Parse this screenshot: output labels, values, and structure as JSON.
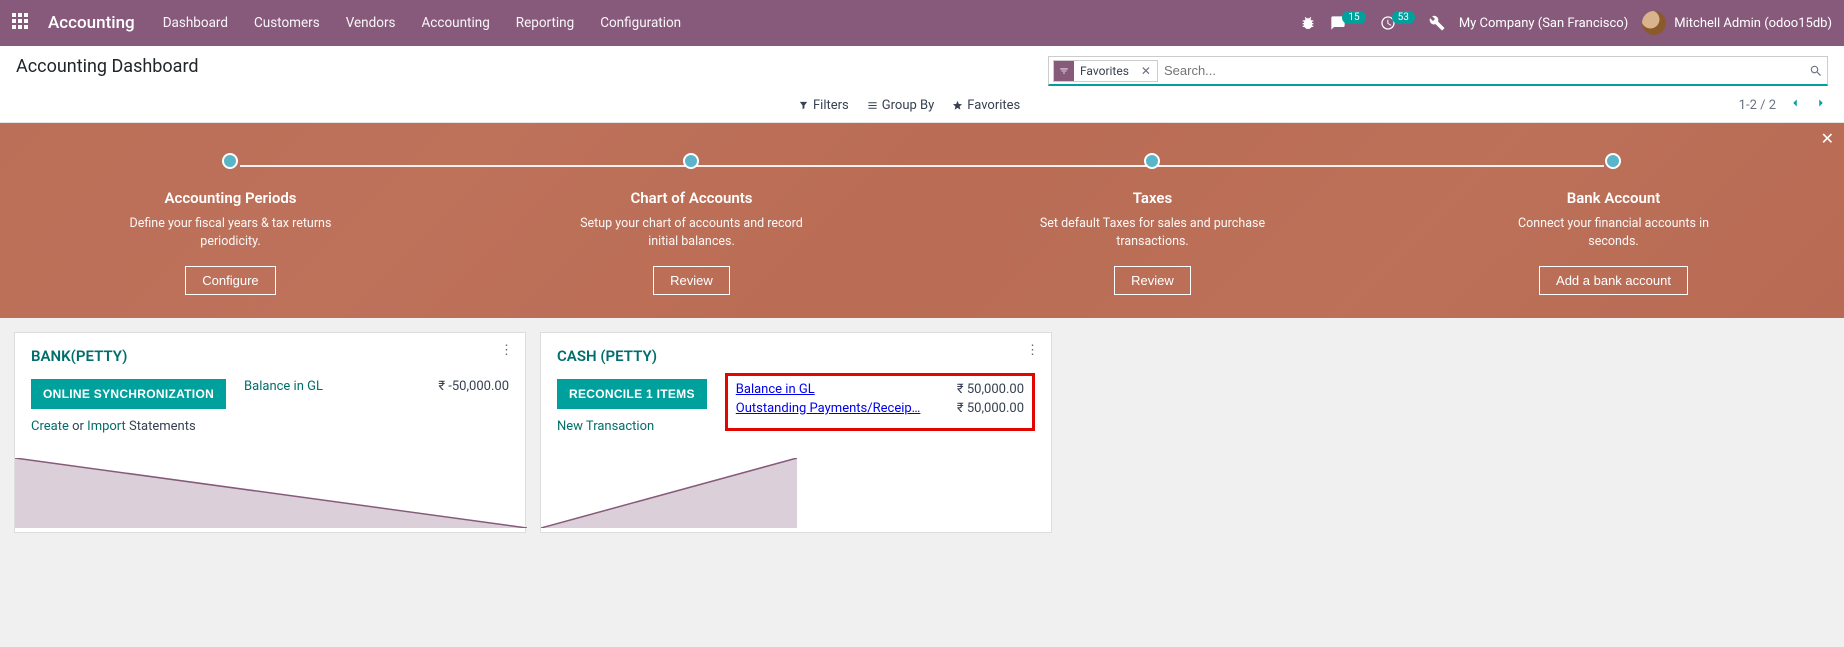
{
  "header": {
    "brand": "Accounting",
    "menu": [
      "Dashboard",
      "Customers",
      "Vendors",
      "Accounting",
      "Reporting",
      "Configuration"
    ],
    "badges": {
      "messages": "15",
      "activities": "53"
    },
    "company": "My Company (San Francisco)",
    "user": "Mitchell Admin (odoo15db)"
  },
  "control_panel": {
    "title": "Accounting Dashboard",
    "facet_label": "Favorites",
    "search_placeholder": "Search...",
    "tools": {
      "filters": "Filters",
      "groupby": "Group By",
      "favorites": "Favorites"
    },
    "pager": "1-2 / 2"
  },
  "onboard": {
    "steps": [
      {
        "title": "Accounting Periods",
        "desc": "Define your fiscal years & tax returns periodicity.",
        "action": "Configure"
      },
      {
        "title": "Chart of Accounts",
        "desc": "Setup your chart of accounts and record initial balances.",
        "action": "Review"
      },
      {
        "title": "Taxes",
        "desc": "Set default Taxes for sales and purchase transactions.",
        "action": "Review"
      },
      {
        "title": "Bank Account",
        "desc": "Connect your financial accounts in seconds.",
        "action": "Add a bank account"
      }
    ]
  },
  "cards": {
    "bank": {
      "title": "BANK(PETTY)",
      "primary_btn": "ONLINE SYNCHRONIZATION",
      "balance_label": "Balance in GL",
      "balance_value": "₹ -50,000.00",
      "link_create": "Create",
      "link_or": "or",
      "link_import": "Import",
      "link_tail": "Statements"
    },
    "cash": {
      "title": "CASH (PETTY)",
      "primary_btn": "RECONCILE 1 ITEMS",
      "rows": [
        {
          "label": "Balance in GL",
          "value": "₹ 50,000.00"
        },
        {
          "label": "Outstanding Payments/Receip…",
          "value": "₹ 50,000.00"
        }
      ],
      "new_tx": "New Transaction"
    }
  }
}
